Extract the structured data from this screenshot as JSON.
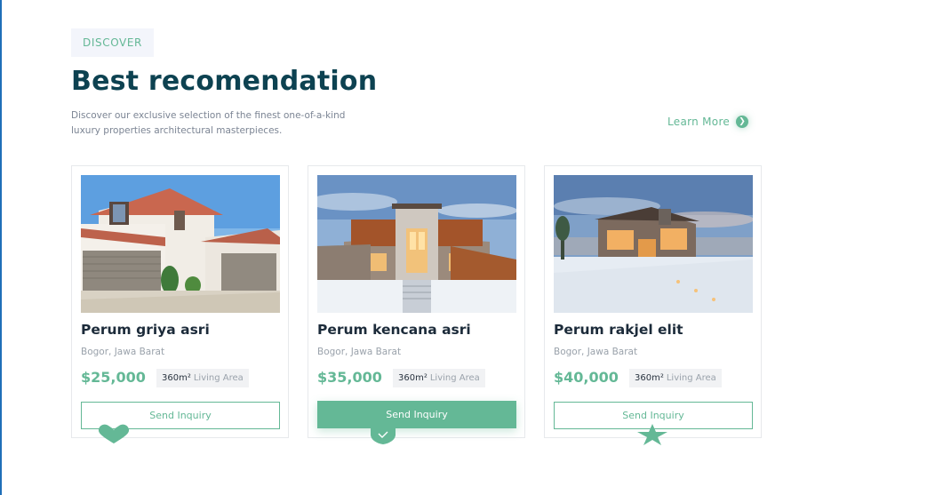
{
  "section": {
    "badge": "DISCOVER",
    "title": "Best recomendation",
    "subtitle": "Discover our exclusive selection of the finest one-of-a-kind luxury properties architectural masterpieces.",
    "learn_more": "Learn More"
  },
  "cards": [
    {
      "name": "Perum griya asri",
      "location": "Bogor, Jawa Barat",
      "price": "$25,000",
      "area_value": "360m²",
      "area_label": "Living Area",
      "button": "Send Inquiry"
    },
    {
      "name": "Perum kencana asri",
      "location": "Bogor, Jawa Barat",
      "price": "$35,000",
      "area_value": "360m²",
      "area_label": "Living Area",
      "button": "Send Inquiry"
    },
    {
      "name": "Perum rakjel elit",
      "location": "Bogor, Jawa Barat",
      "price": "$40,000",
      "area_value": "360m²",
      "area_label": "Living Area",
      "button": "Send Inquiry"
    }
  ],
  "icons": {
    "learn_more": "arrow-right-icon",
    "card1_deco": "heart-icon",
    "card2_deco": "shield-check-icon",
    "card3_deco": "star-icon"
  },
  "colors": {
    "accent": "#64b896",
    "heading": "#0d4251",
    "badge_bg": "#f3f5fb"
  }
}
